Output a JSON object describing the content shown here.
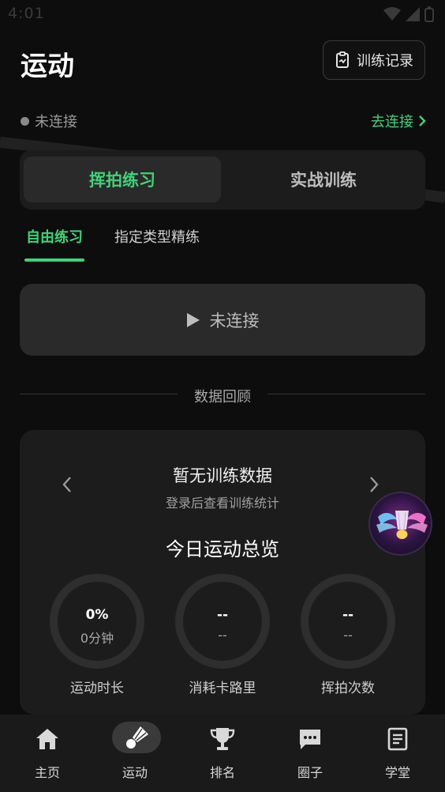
{
  "status_bar": {
    "time": "4:01"
  },
  "header": {
    "title": "运动",
    "record_button": "训练记录"
  },
  "connection": {
    "status": "未连接",
    "connect_link": "去连接"
  },
  "mode_tabs": [
    {
      "label": "挥拍练习",
      "active": true
    },
    {
      "label": "实战训练",
      "active": false
    }
  ],
  "sub_tabs": [
    {
      "label": "自由练习",
      "active": true
    },
    {
      "label": "指定类型精练",
      "active": false
    }
  ],
  "start_button": {
    "label": "未连接",
    "icon": "play-icon"
  },
  "section": {
    "title": "数据回顾"
  },
  "review_card": {
    "title": "暂无训练数据",
    "subtitle": "登录后查看训练统计",
    "overview_title": "今日运动总览",
    "metrics": [
      {
        "value": "0%",
        "sub": "0分钟",
        "label": "运动时长"
      },
      {
        "value": "--",
        "sub": "--",
        "label": "消耗卡路里"
      },
      {
        "value": "--",
        "sub": "--",
        "label": "挥拍次数"
      }
    ]
  },
  "bottom_nav": [
    {
      "label": "主页",
      "icon": "home-icon",
      "active": false
    },
    {
      "label": "运动",
      "icon": "shuttlecock-icon",
      "active": true
    },
    {
      "label": "排名",
      "icon": "trophy-icon",
      "active": false
    },
    {
      "label": "圈子",
      "icon": "chat-icon",
      "active": false
    },
    {
      "label": "学堂",
      "icon": "document-icon",
      "active": false
    }
  ],
  "colors": {
    "accent": "#3fd27a",
    "background": "#0d0d0d",
    "card": "#1c1c1c"
  }
}
